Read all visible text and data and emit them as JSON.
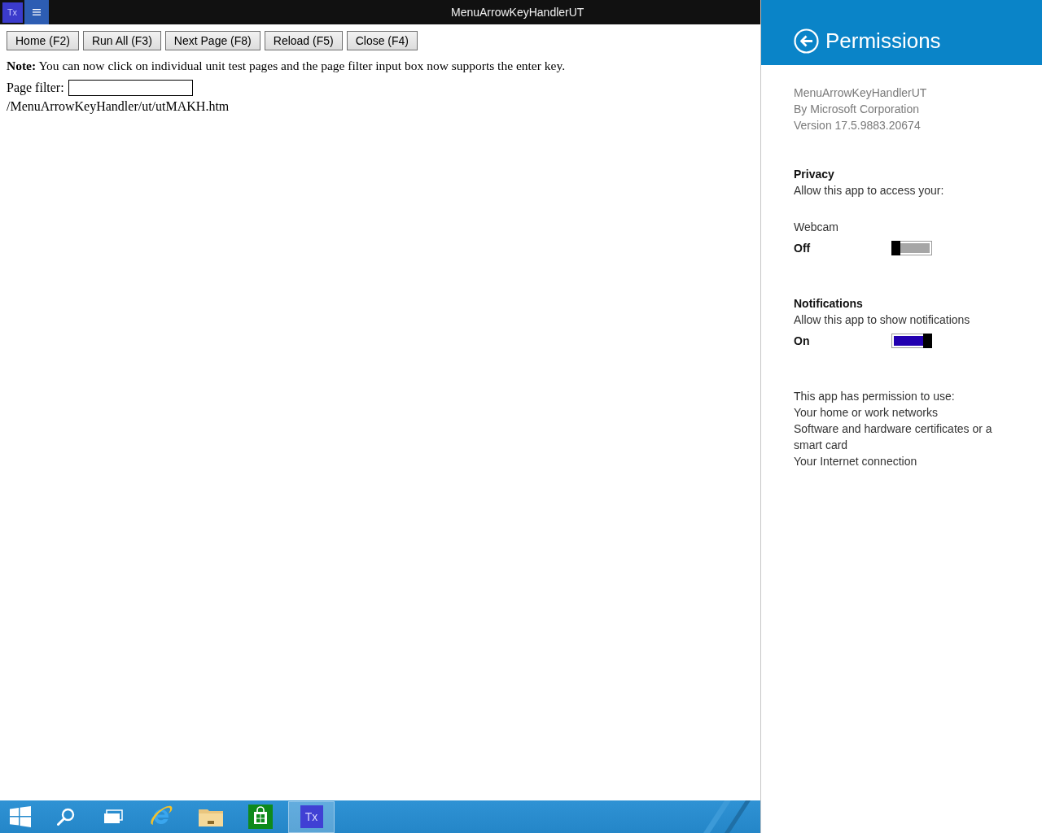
{
  "window": {
    "app_icon_label": "Tx",
    "title": "MenuArrowKeyHandlerUT"
  },
  "toolbar": {
    "buttons": [
      "Home (F2)",
      "Run All (F3)",
      "Next Page (F8)",
      "Reload (F5)",
      "Close (F4)"
    ]
  },
  "note": "**Note:** You can now click on individual unit test pages and the page filter input box now supports the enter key.",
  "page_filter": {
    "label": "Page filter:"
  },
  "test_pages": [
    "/MenuArrowKeyHandler/ut/utMAKH.htm"
  ],
  "permissions_panel": {
    "title": "Permissions",
    "app_info": [
      "MenuArrowKeyHandlerUT",
      "By Microsoft Corporation",
      "Version 17.5.9883.20674"
    ],
    "privacy": {
      "heading": "Privacy",
      "description": "Allow this app to access your:",
      "settings": [
        {
          "label": "Webcam",
          "state_label": "Off",
          "on": false
        }
      ]
    },
    "notifications": {
      "heading": "Notifications",
      "description": "Allow this app to show notifications",
      "state_label": "On",
      "on": true
    },
    "capabilities": {
      "heading": "This app has permission to use:",
      "items": [
        "Your home or work networks",
        "Software and hardware certificates or a smart card",
        "Your Internet connection"
      ]
    }
  },
  "taskbar": {
    "running_app": {
      "label": "Tx",
      "active": true
    }
  }
}
